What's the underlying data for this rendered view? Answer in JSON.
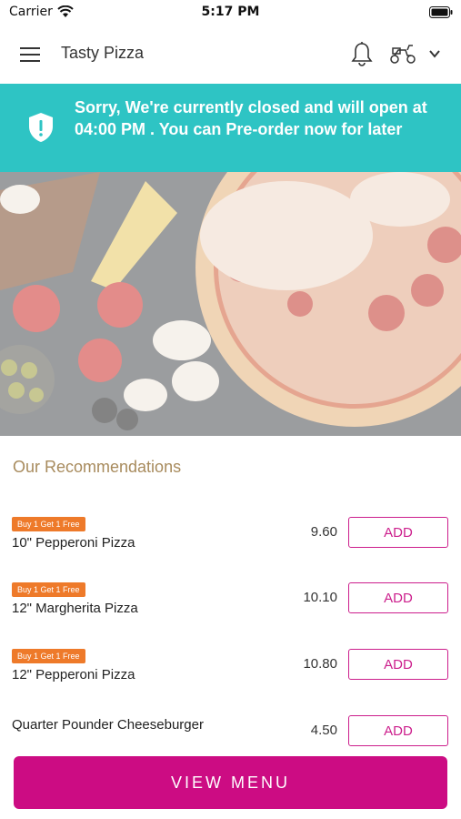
{
  "status_bar": {
    "carrier": "Carrier",
    "time": "5:17 PM"
  },
  "app_bar": {
    "title": "Tasty Pizza"
  },
  "closed_banner": {
    "message": "Sorry, We're currently closed and will open at 04:00 PM . You can Pre-order now for later"
  },
  "recommendations": {
    "title": "Our Recommendations",
    "items": [
      {
        "badge": "Buy 1 Get 1 Free",
        "name": "10\" Pepperoni Pizza",
        "price": "9.60",
        "button": "ADD"
      },
      {
        "badge": "Buy 1 Get 1 Free",
        "name": "12\" Margherita Pizza",
        "price": "10.10",
        "button": "ADD"
      },
      {
        "badge": "Buy 1 Get 1 Free",
        "name": "12\" Pepperoni Pizza",
        "price": "10.80",
        "button": "ADD"
      },
      {
        "badge": "",
        "name": "Quarter Pounder Cheeseburger",
        "price": "4.50",
        "button": "ADD"
      }
    ]
  },
  "footer": {
    "view_menu_label": "VIEW MENU"
  },
  "colors": {
    "teal": "#2ec4c4",
    "magenta": "#cc0c83",
    "promo_orange": "#ee7a2a",
    "section_gold": "#a88b5d"
  }
}
